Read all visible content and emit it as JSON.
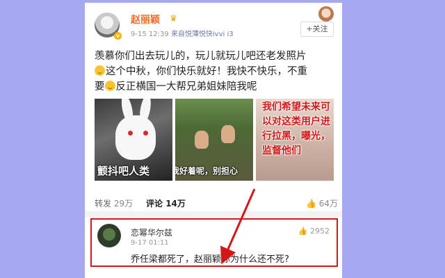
{
  "post": {
    "author_name": "赵丽颖",
    "time": "9-15 12:39",
    "source": "来自悦薄悦快ivvi i3",
    "follow_label": "+关注",
    "text_line1": "羡慕你们出去玩儿的，玩儿就玩儿吧还老发照片",
    "text_line2": "这个中秋，你们快乐就好！我快不快乐，不重",
    "text_line3_a": "要",
    "text_line3_b": "反正横国一大帮兄弟姐妹陪我呢"
  },
  "images": [
    {
      "caption": "颤抖吧人类"
    },
    {
      "caption": "我好着呢，别担心"
    },
    {
      "caption": ""
    }
  ],
  "annotation": "我们希望未来可以对这类用户进行拉黑，曝光，监督他们",
  "actions": {
    "repost_label": "转发",
    "repost_count": "29万",
    "comment_label": "评论",
    "comment_count": "14万",
    "like_count": "64万"
  },
  "comment": {
    "user": "恋幂华尔兹",
    "time": "9-17 01:11",
    "likes": "2952",
    "text": "乔任梁都死了，赵丽颖你为什么还不死?"
  },
  "colors": {
    "background": "#a7a8f2",
    "author_name": "#f06b23",
    "annotation": "#d41616"
  }
}
